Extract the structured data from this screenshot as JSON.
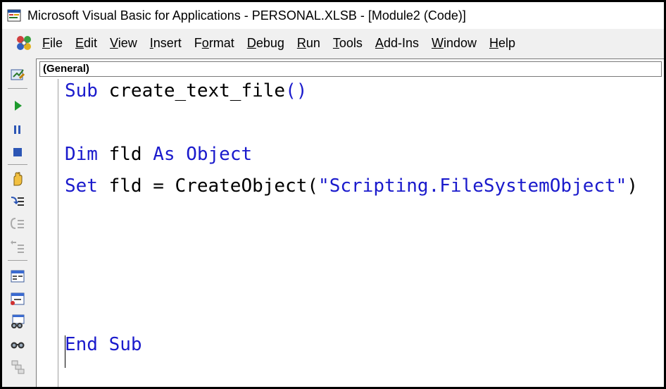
{
  "window": {
    "title": "Microsoft Visual Basic for Applications - PERSONAL.XLSB - [Module2 (Code)]",
    "icon": "vba-app-icon"
  },
  "menubar": {
    "icon": "vba-menu-icon",
    "items": [
      {
        "prefix": "",
        "accel": "F",
        "rest": "ile"
      },
      {
        "prefix": "",
        "accel": "E",
        "rest": "dit"
      },
      {
        "prefix": "",
        "accel": "V",
        "rest": "iew"
      },
      {
        "prefix": "",
        "accel": "I",
        "rest": "nsert"
      },
      {
        "prefix": "F",
        "accel": "o",
        "rest": "rmat"
      },
      {
        "prefix": "",
        "accel": "D",
        "rest": "ebug"
      },
      {
        "prefix": "",
        "accel": "R",
        "rest": "un"
      },
      {
        "prefix": "",
        "accel": "T",
        "rest": "ools"
      },
      {
        "prefix": "",
        "accel": "A",
        "rest": "dd-Ins"
      },
      {
        "prefix": "",
        "accel": "W",
        "rest": "indow"
      },
      {
        "prefix": "",
        "accel": "H",
        "rest": "elp"
      }
    ]
  },
  "toolbar": {
    "tools": [
      "design-mode-icon",
      "run-icon",
      "break-icon",
      "reset-icon",
      "toggle-breakpoint-icon",
      "step-into-icon",
      "step-over-icon",
      "step-out-icon",
      "locals-window-icon",
      "immediate-window-icon",
      "watch-window-icon",
      "quick-watch-icon",
      "call-stack-icon"
    ]
  },
  "editor": {
    "object_combo": "(General)",
    "lines": {
      "l1": {
        "kw1": "Sub",
        "t1": " create_text_file",
        "p1": "()"
      },
      "l2": {
        "kw1": "Dim",
        "t1": " fld ",
        "kw2": "As",
        "t2": " ",
        "kw3": "Object"
      },
      "l3": {
        "kw1": "Set",
        "t1": " fld = CreateObject(",
        "s1": "\"Scripting.FileSystemObject\"",
        "t2": ")"
      },
      "l4": {
        "kw1": "End",
        "t1": " ",
        "kw2": "Sub"
      }
    }
  }
}
